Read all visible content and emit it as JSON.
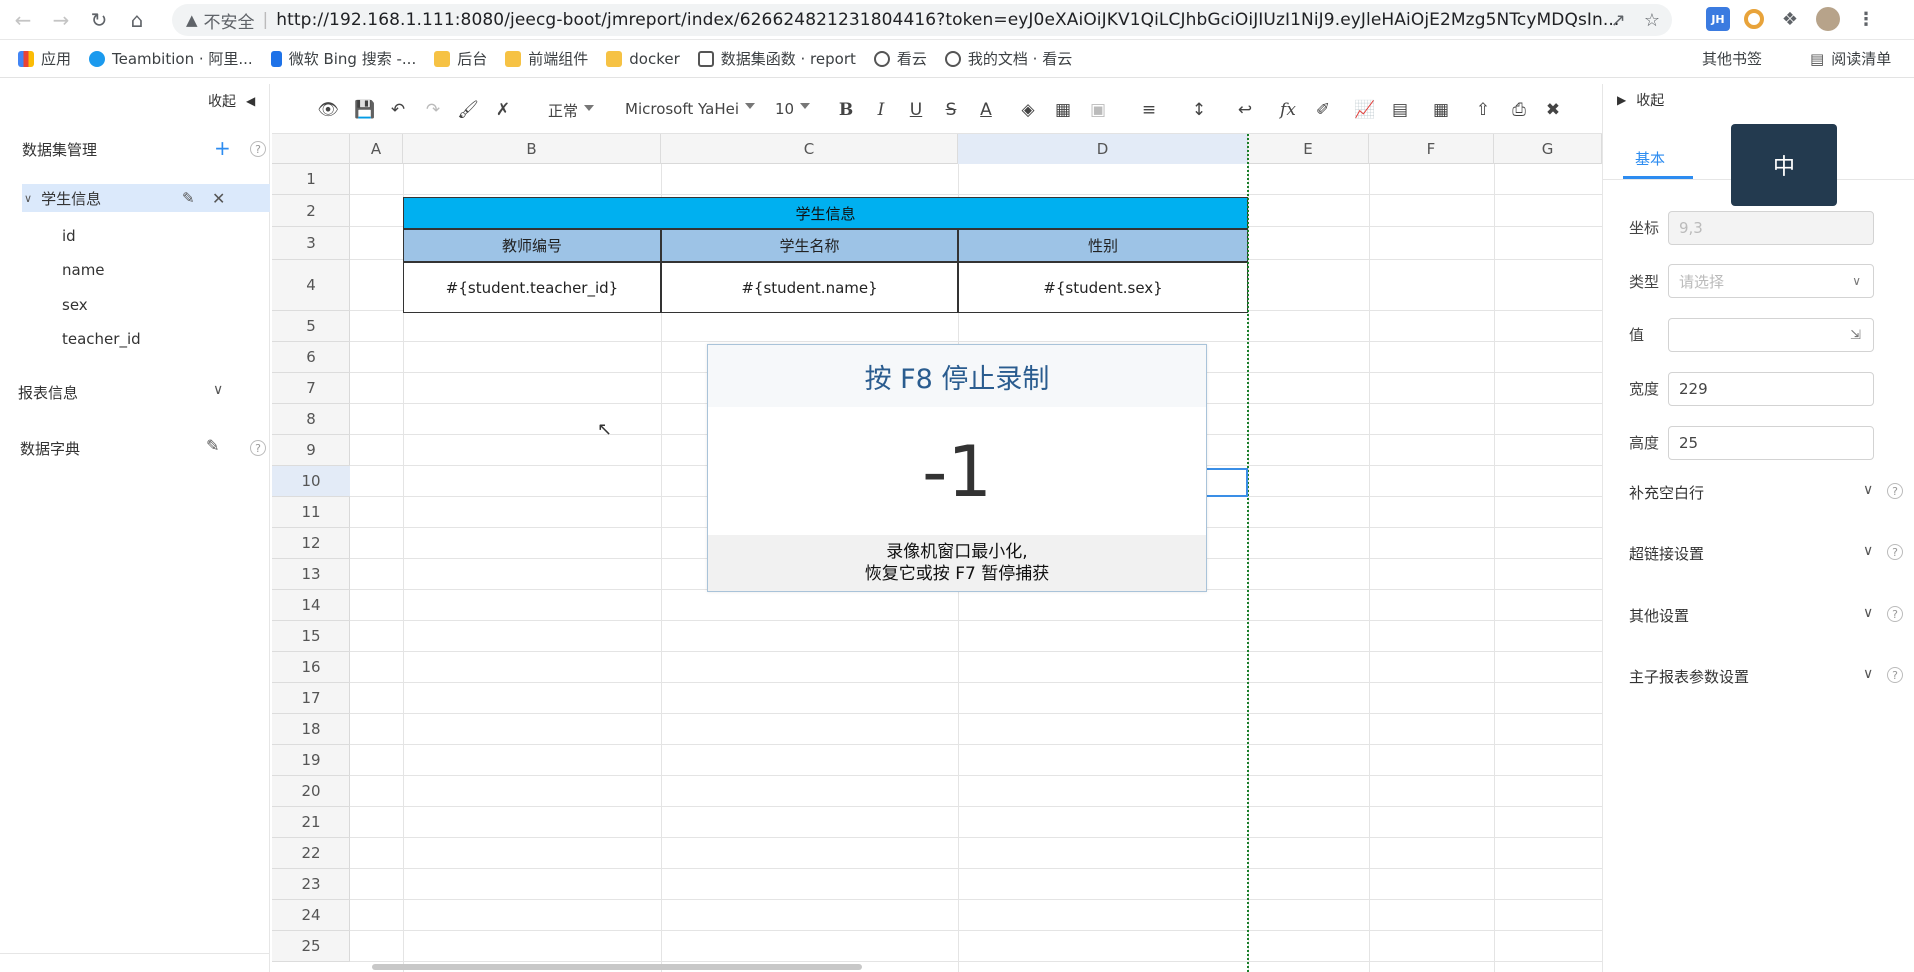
{
  "browser": {
    "insecure_label": "不安全",
    "url": "http://192.168.1.111:8080/jeecg-boot/jmreport/index/626624821231804416?token=eyJ0eXAiOiJKV1QiLCJhbGciOiJIUzI1NiJ9.eyJleHAiOjE2Mzg5NTcyMDQsIn...",
    "ext_jh": "JH"
  },
  "bookmarks": {
    "items": [
      "应用",
      "Teambition · 阿里...",
      "微软 Bing 搜索 -...",
      "后台",
      "前端组件",
      "docker",
      "数据集函数 · report",
      "看云",
      "我的文档 · 看云"
    ],
    "other": "其他书签",
    "reading": "阅读清单"
  },
  "left_panel": {
    "collapse": "收起",
    "dataset_mgmt": "数据集管理",
    "dataset_name": "学生信息",
    "fields": [
      "id",
      "name",
      "sex",
      "teacher_id"
    ],
    "report_info": "报表信息",
    "dictionary": "数据字典"
  },
  "toolbar": {
    "format": "正常",
    "font": "Microsoft YaHei",
    "size": "10"
  },
  "grid": {
    "columns": [
      "A",
      "B",
      "C",
      "D",
      "E",
      "F",
      "G"
    ],
    "rows": [
      "1",
      "2",
      "3",
      "4",
      "5",
      "6",
      "7",
      "8",
      "9",
      "10",
      "11",
      "12",
      "13",
      "14",
      "15",
      "16",
      "17",
      "18",
      "19",
      "20",
      "21",
      "22",
      "23",
      "24",
      "25"
    ],
    "title_cell": "学生信息",
    "header_cells": [
      "教师编号",
      "学生名称",
      "性别"
    ],
    "expr_cells": [
      "#{student.teacher_id}",
      "#{student.name}",
      "#{student.sex}"
    ]
  },
  "recorder": {
    "title": "按 F8 停止录制",
    "count": "-1",
    "msg_line1": "录像机窗口最小化,",
    "msg_line2": "恢复它或按 F7 暂停捕获"
  },
  "right_panel": {
    "collapse": "收起",
    "tab_basic": "基本",
    "ime": "中",
    "coord_label": "坐标",
    "coord_value": "9,3",
    "type_label": "类型",
    "type_placeholder": "请选择",
    "value_label": "值",
    "width_label": "宽度",
    "width_value": "229",
    "height_label": "高度",
    "height_value": "25",
    "sections": [
      "补充空白行",
      "超链接设置",
      "其他设置",
      "主子报表参数设置"
    ]
  }
}
